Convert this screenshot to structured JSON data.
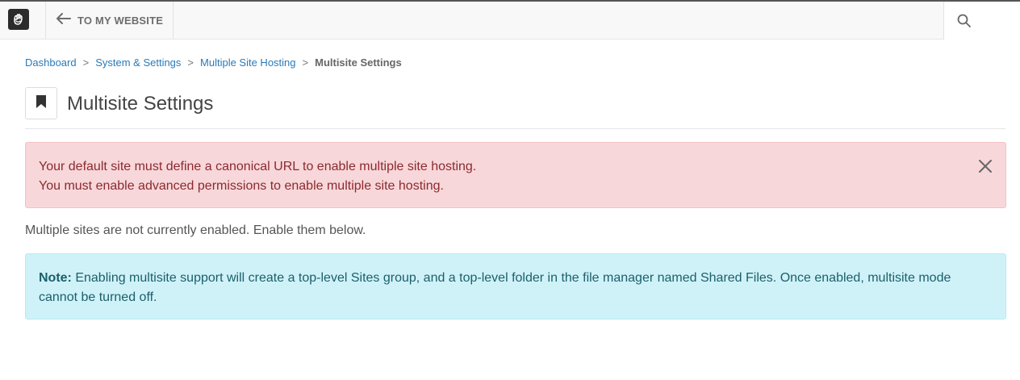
{
  "topbar": {
    "back_label": "TO MY WEBSITE",
    "logo_icon": "concrete-hand-logo-icon",
    "back_icon": "arrow-left-icon",
    "search_icon": "search-icon"
  },
  "breadcrumb": {
    "items": [
      "Dashboard",
      "System & Settings",
      "Multiple Site Hosting"
    ],
    "separator": ">",
    "current": "Multisite Settings"
  },
  "page": {
    "title": "Multisite Settings",
    "title_icon": "bookmark-icon"
  },
  "alerts": {
    "error_lines": [
      "Your default site must define a canonical URL to enable multiple site hosting.",
      "You must enable advanced permissions to enable multiple site hosting."
    ],
    "close_icon": "close-icon"
  },
  "status_text": "Multiple sites are not currently enabled. Enable them below.",
  "note": {
    "label": "Note:",
    "text": " Enabling multisite support will create a top-level Sites group, and a top-level folder in the file manager named Shared Files. Once enabled, multisite mode cannot be turned off."
  },
  "colors": {
    "link": "#2a7ab8",
    "danger_bg": "#f8d7da",
    "danger_text": "#8b2a2f",
    "info_bg": "#cff2f8",
    "info_text": "#1c5f6b"
  }
}
